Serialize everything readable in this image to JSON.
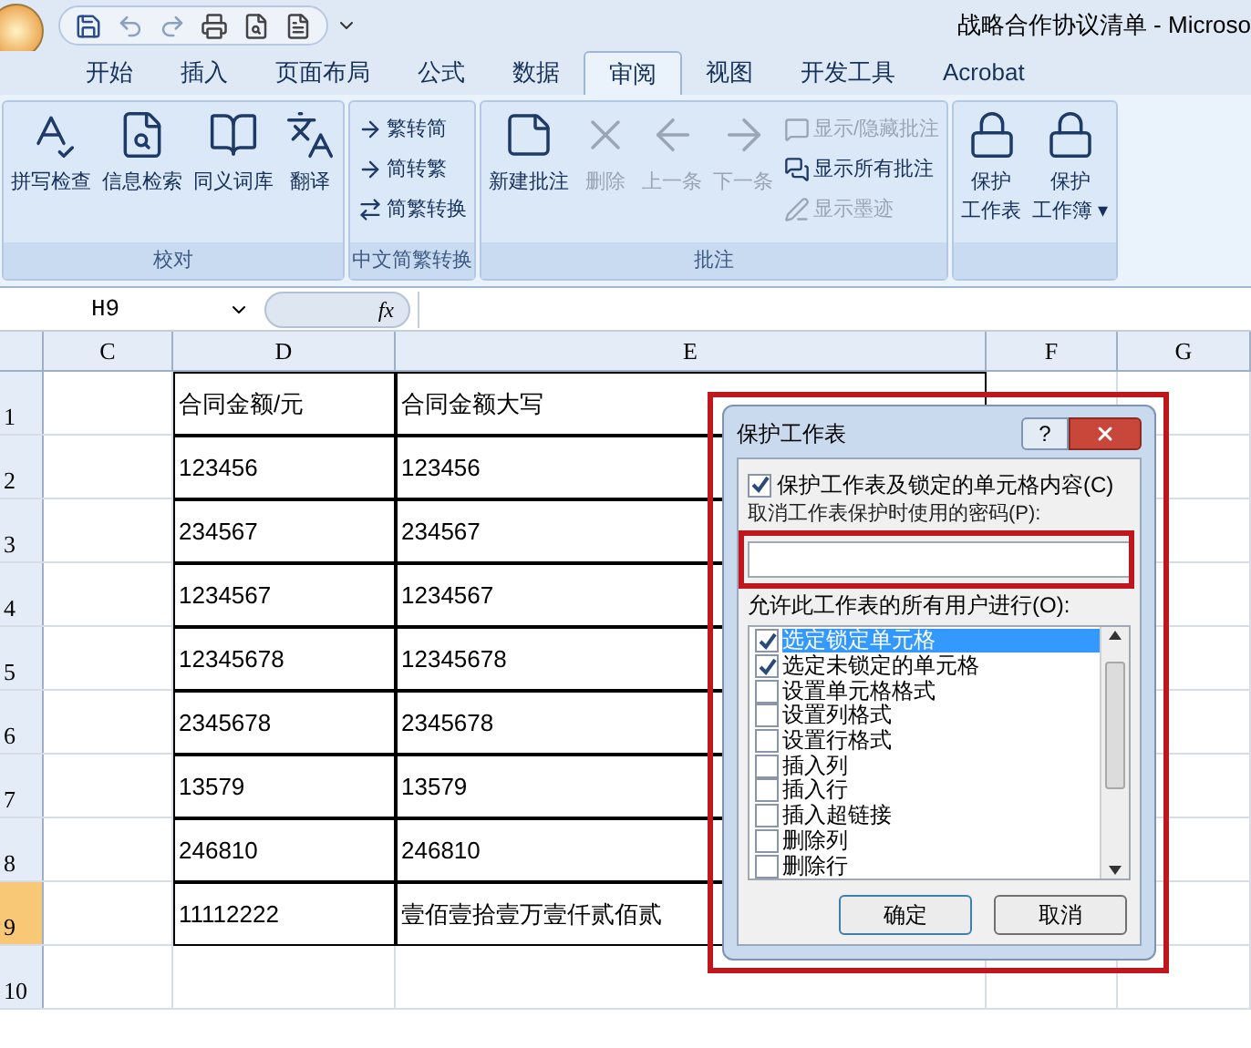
{
  "window": {
    "title": "战略合作协议清单 - Microso"
  },
  "ribbon_tabs": [
    {
      "label": "开始",
      "selected": false
    },
    {
      "label": "插入",
      "selected": false
    },
    {
      "label": "页面布局",
      "selected": false
    },
    {
      "label": "公式",
      "selected": false
    },
    {
      "label": "数据",
      "selected": false
    },
    {
      "label": "审阅",
      "selected": true
    },
    {
      "label": "视图",
      "selected": false
    },
    {
      "label": "开发工具",
      "selected": false
    },
    {
      "label": "Acrobat",
      "selected": false
    }
  ],
  "ribbon_groups": [
    {
      "label": "校对",
      "buttons": [
        {
          "label": "拼写检查",
          "kind": "large",
          "disabled": false
        },
        {
          "label": "信息检索",
          "kind": "large",
          "disabled": false
        },
        {
          "label": "同义词库",
          "kind": "large",
          "disabled": false
        },
        {
          "label": "翻译",
          "kind": "large",
          "disabled": false
        }
      ]
    },
    {
      "label": "中文简繁转换",
      "buttons": [
        {
          "label": "繁转简",
          "kind": "small",
          "disabled": false
        },
        {
          "label": "简转繁",
          "kind": "small",
          "disabled": false
        },
        {
          "label": "简繁转换",
          "kind": "small",
          "disabled": false
        }
      ]
    },
    {
      "label": "批注",
      "buttons": [
        {
          "label": "新建批注",
          "kind": "large",
          "disabled": false
        },
        {
          "label": "删除",
          "kind": "large",
          "disabled": true
        },
        {
          "label": "上一条",
          "kind": "large",
          "disabled": true
        },
        {
          "label": "下一条",
          "kind": "large",
          "disabled": true
        },
        {
          "label": "显示/隐藏批注",
          "kind": "small",
          "disabled": true
        },
        {
          "label": "显示所有批注",
          "kind": "small",
          "disabled": false
        },
        {
          "label": "显示墨迹",
          "kind": "small",
          "disabled": true
        }
      ]
    },
    {
      "buttons": [
        {
          "lines": [
            "保护",
            "工作表"
          ],
          "kind": "large",
          "disabled": false
        },
        {
          "lines": [
            "保护",
            "工作簿 ▾"
          ],
          "kind": "large",
          "disabled": false
        }
      ]
    }
  ],
  "formula_bar": {
    "name_box": "H9",
    "fx": "fx"
  },
  "columns": [
    "C",
    "D",
    "E",
    "F",
    "G"
  ],
  "rows": [
    {
      "header": "1",
      "selected": false,
      "cells": [
        "合同金额/元",
        "合同金额大写"
      ]
    },
    {
      "header": "2",
      "selected": false,
      "cells": [
        "123456",
        "123456"
      ]
    },
    {
      "header": "3",
      "selected": false,
      "cells": [
        "234567",
        "234567"
      ]
    },
    {
      "header": "4",
      "selected": false,
      "cells": [
        "1234567",
        "1234567"
      ]
    },
    {
      "header": "5",
      "selected": false,
      "cells": [
        "12345678",
        "12345678"
      ]
    },
    {
      "header": "6",
      "selected": false,
      "cells": [
        "2345678",
        "2345678"
      ]
    },
    {
      "header": "7",
      "selected": false,
      "cells": [
        "13579",
        "13579"
      ]
    },
    {
      "header": "8",
      "selected": false,
      "cells": [
        "246810",
        "246810"
      ]
    },
    {
      "header": "9",
      "selected": true,
      "cells": [
        "11112222",
        "壹佰壹拾壹万壹仟贰佰贰"
      ]
    },
    {
      "header": "10",
      "selected": false
    }
  ],
  "dialog": {
    "title": "保护工作表",
    "help": "?",
    "protect": {
      "label": "保护工作表及锁定的单元格内容(C)",
      "checked": true
    },
    "password_label": "取消工作表保护时使用的密码(P):",
    "allow_label": "允许此工作表的所有用户进行(O):",
    "permissions": [
      {
        "label": "选定锁定单元格",
        "checked": true,
        "selected": true
      },
      {
        "label": "选定未锁定的单元格",
        "checked": true,
        "selected": false
      },
      {
        "label": "设置单元格格式",
        "checked": false,
        "selected": false
      },
      {
        "label": "设置列格式",
        "checked": false,
        "selected": false
      },
      {
        "label": "设置行格式",
        "checked": false,
        "selected": false
      },
      {
        "label": "插入列",
        "checked": false,
        "selected": false
      },
      {
        "label": "插入行",
        "checked": false,
        "selected": false
      },
      {
        "label": "插入超链接",
        "checked": false,
        "selected": false
      },
      {
        "label": "删除列",
        "checked": false,
        "selected": false
      },
      {
        "label": "删除行",
        "checked": false,
        "selected": false
      }
    ],
    "buttons": [
      "确定",
      "取消"
    ]
  }
}
